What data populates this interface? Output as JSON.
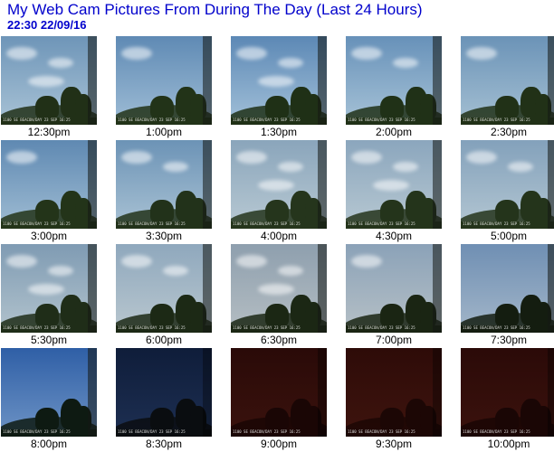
{
  "header": {
    "title": "My Web Cam Pictures From During The Day (Last 24 Hours)",
    "timestamp": "22:30  22/09/16"
  },
  "thumbnails": [
    {
      "time": "12:30pm",
      "caption": "1100 SE BEACON/DAY 23 SEP 16:25",
      "sky_top": "#6e95b8",
      "sky_bottom": "#a9c3d6",
      "ground": "#213017",
      "clouds": 3
    },
    {
      "time": "1:00pm",
      "caption": "1100 SE BEACON/DAY 23 SEP 16:25",
      "sky_top": "#5f8ab4",
      "sky_bottom": "#9fbdd6",
      "ground": "#223318",
      "clouds": 1
    },
    {
      "time": "1:30pm",
      "caption": "1100 SE BEACON/DAY 23 SEP 16:25",
      "sky_top": "#5c88b5",
      "sky_bottom": "#a3c1d9",
      "ground": "#1f3016",
      "clouds": 3
    },
    {
      "time": "2:00pm",
      "caption": "1100 SE BEACON/DAY 23 SEP 16:25",
      "sky_top": "#6791b9",
      "sky_bottom": "#a7c3d7",
      "ground": "#203117",
      "clouds": 2
    },
    {
      "time": "2:30pm",
      "caption": "1100 SE BEACON/DAY 23 SEP 16:25",
      "sky_top": "#6b93b7",
      "sky_bottom": "#a5c0d3",
      "ground": "#213117",
      "clouds": 1
    },
    {
      "time": "3:00pm",
      "caption": "1100 SE BEACON/DAY 23 SEP 16:25",
      "sky_top": "#5f89b2",
      "sky_bottom": "#9fbcd3",
      "ground": "#233419",
      "clouds": 1
    },
    {
      "time": "3:30pm",
      "caption": "1100 SE BEACON/DAY 23 SEP 16:25",
      "sky_top": "#6c93b6",
      "sky_bottom": "#a9c2d4",
      "ground": "#22321a",
      "clouds": 2
    },
    {
      "time": "4:00pm",
      "caption": "1100 SE BEACON/DAY 23 SEP 16:25",
      "sky_top": "#8aa5bb",
      "sky_bottom": "#b8c9d3",
      "ground": "#25351c",
      "clouds": 3
    },
    {
      "time": "4:30pm",
      "caption": "1100 SE BEACON/DAY 23 SEP 16:25",
      "sky_top": "#8ba6bd",
      "sky_bottom": "#b7c8d2",
      "ground": "#24341b",
      "clouds": 3
    },
    {
      "time": "5:00pm",
      "caption": "1100 SE BEACON/DAY 23 SEP 16:25",
      "sky_top": "#83a1bb",
      "sky_bottom": "#b3c6d2",
      "ground": "#24341b",
      "clouds": 2
    },
    {
      "time": "5:30pm",
      "caption": "1100 SE BEACON/DAY 23 SEP 16:25",
      "sky_top": "#7f9bb3",
      "sky_bottom": "#b2c3cd",
      "ground": "#1f2d18",
      "clouds": 3
    },
    {
      "time": "6:00pm",
      "caption": "1100 SE BEACON/DAY 23 SEP 16:25",
      "sky_top": "#8fa8bd",
      "sky_bottom": "#b9c7cf",
      "ground": "#1c2915",
      "clouds": 2
    },
    {
      "time": "6:30pm",
      "caption": "1100 SE BEACON/DAY 23 SEP 16:25",
      "sky_top": "#8e9fae",
      "sky_bottom": "#b5bec3",
      "ground": "#1b2714",
      "clouds": 3
    },
    {
      "time": "7:00pm",
      "caption": "1100 SE BEACON/DAY 23 SEP 16:25",
      "sky_top": "#8ba2b8",
      "sky_bottom": "#b6c0c6",
      "ground": "#1a2513",
      "clouds": 1
    },
    {
      "time": "7:30pm",
      "caption": "1100 SE BEACON/DAY 23 SEP 16:25",
      "sky_top": "#6f8fb3",
      "sky_bottom": "#a3b6c9",
      "ground": "#141d10",
      "clouds": 0
    },
    {
      "time": "8:00pm",
      "caption": "1100 SE BEACON/DAY 23 SEP 16:25",
      "sky_top": "#2f5fa6",
      "sky_bottom": "#6d93c5",
      "ground": "#0e1a12",
      "clouds": 0
    },
    {
      "time": "8:30pm",
      "caption": "1100 SE BEACON/DAY 23 SEP 16:25",
      "sky_top": "#0f1d3a",
      "sky_bottom": "#1d2f52",
      "ground": "#0a0d10",
      "clouds": 0
    },
    {
      "time": "9:00pm",
      "caption": "1100 SE BEACON/DAY 23 SEP 16:25",
      "sky_top": "#2a0a08",
      "sky_bottom": "#3a120d",
      "ground": "#1a0605",
      "clouds": 0
    },
    {
      "time": "9:30pm",
      "caption": "1100 SE BEACON/DAY 23 SEP 16:25",
      "sky_top": "#2e0b08",
      "sky_bottom": "#3e140e",
      "ground": "#1c0705",
      "clouds": 0
    },
    {
      "time": "10:00pm",
      "caption": "1100 SE BEACON/DAY 23 SEP 16:25",
      "sky_top": "#2b0a08",
      "sky_bottom": "#3b120d",
      "ground": "#1a0605",
      "clouds": 0
    }
  ]
}
